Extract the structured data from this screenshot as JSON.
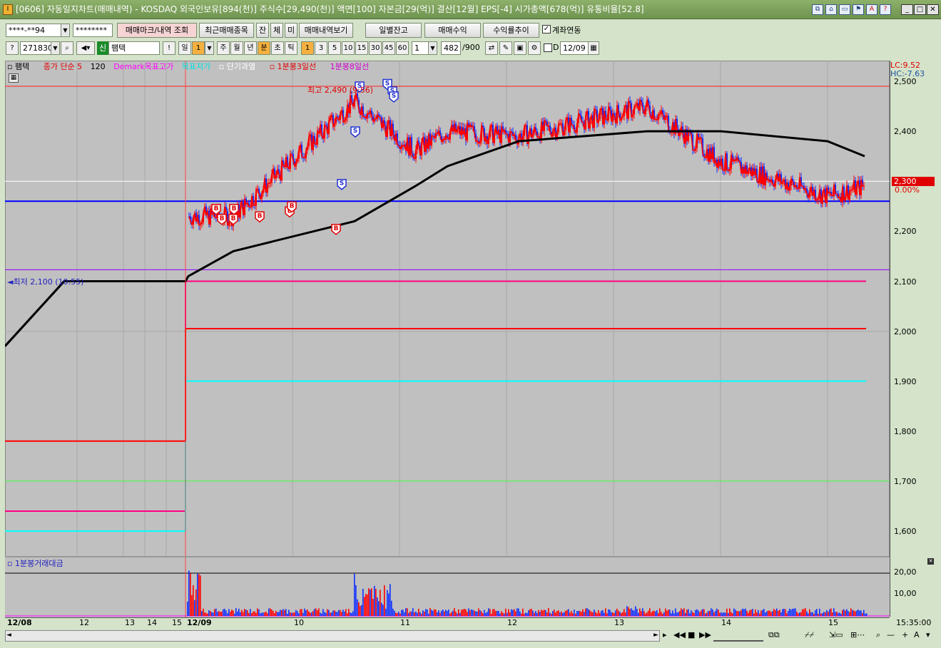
{
  "window": {
    "title": "[0606] 자동일지차트(매매내역) - KOSDAQ 외국인보유[894(천)] 주식수[29,490(천)] 액면[100] 자본금[29(억)] 결산[12월] EPS[-4] 시가총액[678(억)] 유통비율[52.8]",
    "app_icon": "I"
  },
  "toolbar1": {
    "account": "****-**94",
    "password": "********",
    "btn_mark": "매매마크/내역 조회",
    "btn_recent": "최근매매종목",
    "btn_jan": "잔",
    "btn_che": "체",
    "btn_mi": "미",
    "btn_history": "매매내역보기",
    "btn_daily_balance": "일별잔고",
    "btn_profit": "매매수익",
    "btn_cum": "수익률추이",
    "link_label": "계좌연동"
  },
  "toolbar2": {
    "code": "271830",
    "badge": "신",
    "stock_name": "팸텍",
    "exclaim": "!",
    "period_il": "일",
    "period_num": "1",
    "ju": "주",
    "wol": "월",
    "nyeon": "년",
    "bun": "분",
    "cho": "초",
    "tik": "틱",
    "minutes": [
      "1",
      "3",
      "5",
      "10",
      "15",
      "30",
      "45",
      "60"
    ],
    "custom": "1",
    "count": "482",
    "count_total": "/900",
    "d_label": "D",
    "date": "12/09"
  },
  "legend": {
    "items": [
      {
        "text": "팸텍",
        "color": "#000000"
      },
      {
        "text": "종가 단순 5",
        "color": "#ff0000"
      },
      {
        "text": "120",
        "color": "#000000"
      },
      {
        "text": "Demark목표고가",
        "color": "#ff00ff"
      },
      {
        "text": "목표저가",
        "color": "#00ffff"
      },
      {
        "text": "단기과열",
        "color": "#ffffff"
      },
      {
        "text": "1분봉3일선",
        "color": "#ff0000"
      },
      {
        "text": "1분봉8일선",
        "color": "#ff00ff"
      }
    ]
  },
  "chart": {
    "high_label": "최고 2,490 (9:56)",
    "low_label": "최저 2,100 (10:55)",
    "lc": "LC:9.52",
    "hc": "HC:-7.63",
    "current_price": "2,300",
    "current_pct": "0.00%",
    "y_ticks": [
      "2,500",
      "2,400",
      "2,300",
      "2,200",
      "2,100",
      "2,000",
      "1,900",
      "1,800",
      "1,700",
      "1,600"
    ],
    "x_ticks": [
      "12/08",
      "12",
      "13",
      "14",
      "15",
      "12/09",
      "10",
      "11",
      "12",
      "13",
      "14",
      "15"
    ],
    "time_label": "15:35:00",
    "colors": {
      "up": "#ff0000",
      "down": "#0000ff",
      "ma120": "#000000",
      "bg": "#c0c0c0"
    }
  },
  "chart_data": {
    "type": "line",
    "title": "",
    "ylim": [
      1560,
      2520
    ],
    "x": [
      "12/08 09:00",
      "12/08 12:00",
      "12/08 15:30",
      "12/09 09:00",
      "12/09 09:30",
      "12/09 10:00",
      "12/09 10:55",
      "12/09 11:30",
      "12/09 12:30",
      "12/09 13:30",
      "12/09 14:00",
      "12/09 15:00",
      "12/09 15:30"
    ],
    "series": [
      {
        "name": "팸텍",
        "values": [
          1970,
          2100,
          2100,
          2230,
          2230,
          2460,
          2360,
          2400,
          2390,
          2450,
          2340,
          2270,
          2290
        ]
      },
      {
        "name": "120",
        "values": [
          1970,
          2100,
          2100,
          2110,
          2160,
          2220,
          2290,
          2330,
          2380,
          2400,
          2400,
          2380,
          2350
        ]
      }
    ],
    "levels": [
      {
        "name": "Demark목표고가",
        "before": 1640,
        "after": 2100
      },
      {
        "name": "목표저가",
        "before": 1600,
        "after": 1900
      },
      {
        "name": "1분봉3일선",
        "before": 1780,
        "after": 2005
      },
      {
        "name": "1분봉8일선",
        "value": 1700
      },
      {
        "name": "단기과열",
        "value": 2300
      }
    ],
    "markers": [
      {
        "type": "B",
        "count": 8
      },
      {
        "type": "S",
        "count": 6
      }
    ]
  },
  "volume": {
    "title": "1분봉거래대금",
    "y_ticks": [
      "20,00",
      "10,00"
    ]
  }
}
